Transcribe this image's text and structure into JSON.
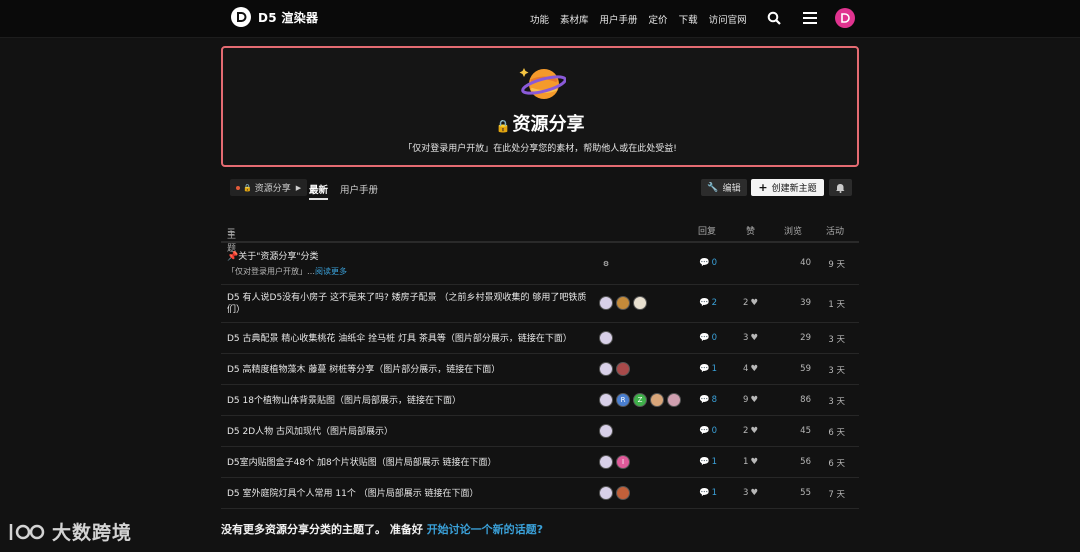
{
  "header": {
    "brand": "D5 渲染器",
    "nav": [
      "功能",
      "素材库",
      "用户手册",
      "定价",
      "下载",
      "访问官网"
    ],
    "icons": [
      "search-icon",
      "menu-icon",
      "user-avatar"
    ]
  },
  "banner": {
    "icon": "planet-emoji",
    "title": "资源分享",
    "description": "「仅对登录用户开放」在此处分享您的素材，帮助他人或在此处受益!"
  },
  "filters": {
    "category": "资源分享",
    "tabs": [
      "最新",
      "用户手册"
    ],
    "active_tab": "最新",
    "edit_label": "编辑",
    "new_topic_label": "创建新主题"
  },
  "table": {
    "headers": {
      "topic": "主题",
      "replies": "回复",
      "likes": "赞",
      "views": "浏览",
      "activity": "活动"
    },
    "rows": [
      {
        "title": "关于\"资源分享\"分类",
        "pinned": true,
        "excerpt": "「仅对登录用户开放」…",
        "read_more": "阅读更多",
        "replies": "0",
        "likes": "",
        "views": "40",
        "activity": "9 天"
      },
      {
        "title": "D5 有人说D5没有小房子 这不是来了吗? 矮房子配景 （之前乡村景观收集的 够用了吧铁质",
        "title2": "们）",
        "replies": "2",
        "likes": "2",
        "views": "39",
        "activity": "1 天"
      },
      {
        "title": "D5 古典配景 精心收集桃花 油纸伞 拴马桩 灯具 茶具等（图片部分展示，链接在下面）",
        "replies": "0",
        "likes": "3",
        "views": "29",
        "activity": "3 天"
      },
      {
        "title": "D5 高精度植物藻木 藤蔓 树桩等分享（图片部分展示，链接在下面）",
        "replies": "1",
        "likes": "4",
        "views": "59",
        "activity": "3 天"
      },
      {
        "title": "D5 18个植物山体背景贴图（图片局部展示，链接在下面）",
        "replies": "8",
        "likes": "9",
        "views": "86",
        "activity": "3 天"
      },
      {
        "title": "D5 2D人物 古风加现代（图片局部展示）",
        "replies": "0",
        "likes": "2",
        "views": "45",
        "activity": "6 天"
      },
      {
        "title": "D5室内贴图盒子48个 加8个片状贴图（图片局部展示 链接在下面）",
        "replies": "1",
        "likes": "1",
        "views": "56",
        "activity": "6 天"
      },
      {
        "title": "D5 室外庭院灯具个人常用 11个 （图片局部展示 链接在下面）",
        "replies": "1",
        "likes": "3",
        "views": "55",
        "activity": "7 天"
      }
    ]
  },
  "footer": {
    "text": "没有更多资源分享分类的主题了。 准备好",
    "link": "开始讨论一个新的话题?"
  },
  "watermark": "大数跨境",
  "colors": {
    "accent": "#3aa0d8",
    "banner_border": "#e46b72",
    "brand_pink": "#e0338f"
  }
}
